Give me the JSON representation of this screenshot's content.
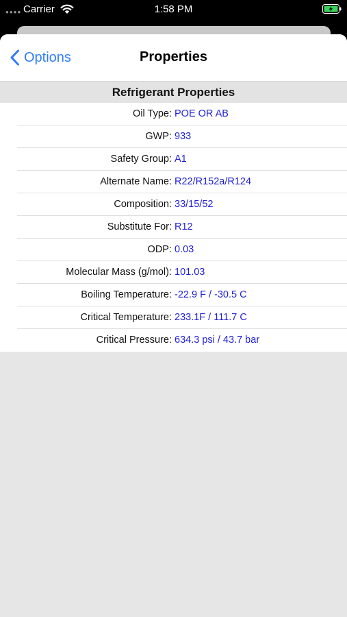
{
  "status_bar": {
    "carrier": "Carrier",
    "time": "1:58 PM"
  },
  "nav": {
    "back_label": "Options",
    "title": "Properties"
  },
  "section": {
    "title": "Refrigerant Properties"
  },
  "properties": [
    {
      "label": "Oil Type:",
      "value": "POE OR AB"
    },
    {
      "label": "GWP:",
      "value": "933"
    },
    {
      "label": "Safety Group:",
      "value": "A1"
    },
    {
      "label": "Alternate Name:",
      "value": "R22/R152a/R124"
    },
    {
      "label": "Composition:",
      "value": "33/15/52"
    },
    {
      "label": "Substitute For:",
      "value": "R12"
    },
    {
      "label": "ODP:",
      "value": "0.03"
    },
    {
      "label": "Molecular Mass (g/mol):",
      "value": "101.03"
    },
    {
      "label": "Boiling Temperature:",
      "value": "-22.9 F / -30.5 C"
    },
    {
      "label": "Critical Temperature:",
      "value": "233.1F / 111.7 C"
    },
    {
      "label": "Critical Pressure:",
      "value": "634.3 psi / 43.7 bar"
    }
  ],
  "colors": {
    "accent": "#2f7cf6",
    "value_text": "#1f1fd6",
    "battery_charging": "#3cd25a"
  },
  "icons": [
    "wifi-icon",
    "battery-charging-icon",
    "chevron-left-icon"
  ]
}
